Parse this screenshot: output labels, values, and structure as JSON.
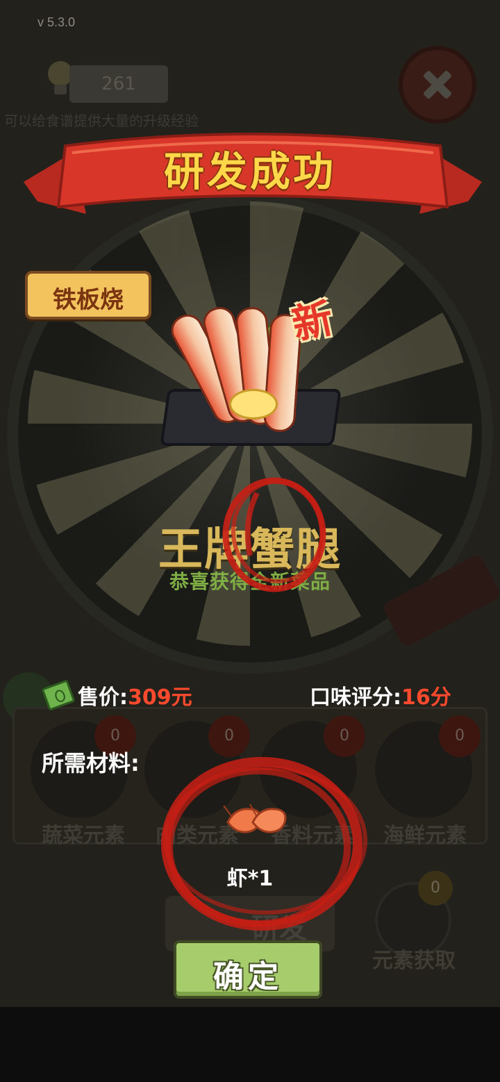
{
  "version": "v 5.3.0",
  "background": {
    "exp_value": "261",
    "hint_text": "可以给食谱提供大量的升级经验",
    "elements": [
      {
        "label": "蔬菜元素",
        "count": "0"
      },
      {
        "label": "肉类元素",
        "count": "0"
      },
      {
        "label": "香料元素",
        "count": "0"
      },
      {
        "label": "海鲜元素",
        "count": "0"
      }
    ],
    "research_label": "研发",
    "fetch_label": "元素获取",
    "fetch_count": "0"
  },
  "popup": {
    "title": "研发成功",
    "category": "铁板烧",
    "new_badge": "新",
    "dish_name": "王牌蟹腿",
    "dish_subtitle": "恭喜获得全新菜品",
    "price_label": "售价:",
    "price_value": "309元",
    "rating_label": "口味评分:",
    "rating_value": "16分",
    "materials_label": "所需材料:",
    "material_qty": "虾*1",
    "confirm_label": "确定"
  },
  "colors": {
    "title_yellow": "#ffd84a",
    "ribbon_red": "#d9362a",
    "price_red": "#ff4a2e",
    "confirm_green": "#a7cc6c",
    "annotation_red": "#c81e14"
  }
}
